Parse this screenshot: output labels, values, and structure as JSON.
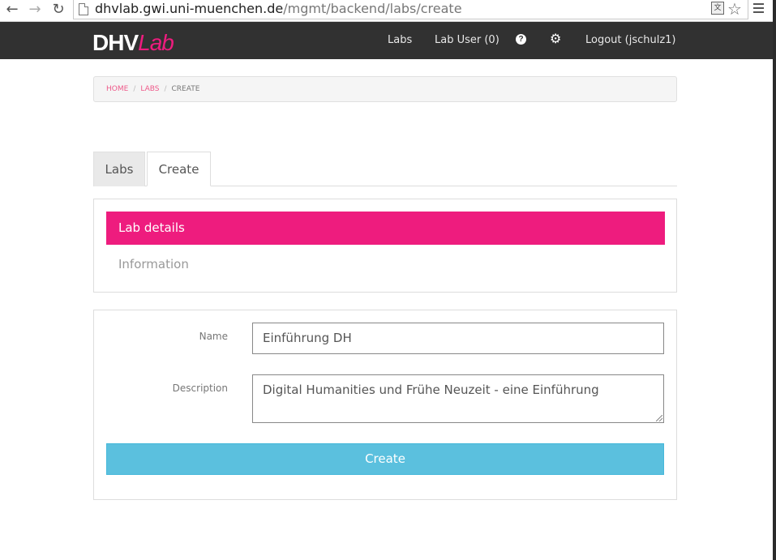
{
  "browser": {
    "url_host": "dhvlab.gwi.uni-muenchen.de",
    "url_path": "/mgmt/backend/labs/create"
  },
  "navbar": {
    "brand_main": "DHV",
    "brand_accent": "Lab",
    "links": {
      "labs": "Labs",
      "lab_user": "Lab User (0)",
      "logout": "Logout (jschulz1)"
    }
  },
  "breadcrumb": {
    "home": "HOME",
    "labs": "LABS",
    "current": "CREATE"
  },
  "tabs": {
    "labs": "Labs",
    "create": "Create"
  },
  "details_panel": {
    "active_item": "Lab details",
    "info_item": "Information"
  },
  "form": {
    "name_label": "Name",
    "name_value": "Einführung DH",
    "description_label": "Description",
    "description_value": "Digital Humanities und Frühe Neuzeit - eine Einführung",
    "submit_label": "Create"
  },
  "colors": {
    "brand_pink": "#ee1c7e",
    "navbar_bg": "#313131",
    "button_blue": "#5bc0de"
  }
}
